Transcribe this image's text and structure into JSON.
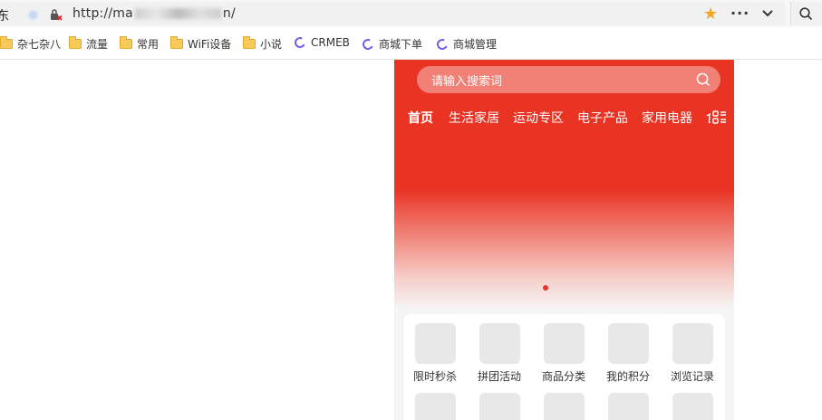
{
  "browser": {
    "edge_char": "东",
    "url_prefix": "http://ma",
    "url_suffix": "n/",
    "bookmarks": [
      {
        "type": "folder",
        "label": "杂七杂八"
      },
      {
        "type": "folder",
        "label": "流量"
      },
      {
        "type": "folder",
        "label": "常用"
      },
      {
        "type": "folder",
        "label": "WiFi设备"
      },
      {
        "type": "folder",
        "label": "小说"
      },
      {
        "type": "site",
        "label": "CRMEB"
      },
      {
        "type": "site",
        "label": "商城下单"
      },
      {
        "type": "site",
        "label": "商城管理"
      }
    ]
  },
  "app": {
    "search_placeholder": "请输入搜索词",
    "nav_tabs": [
      "首页",
      "生活家居",
      "运动专区",
      "电子产品",
      "家用电器",
      "食品"
    ],
    "menu": [
      "限时秒杀",
      "拼团活动",
      "商品分类",
      "我的积分",
      "浏览记录"
    ],
    "colors": {
      "primary": "#e93323"
    }
  }
}
